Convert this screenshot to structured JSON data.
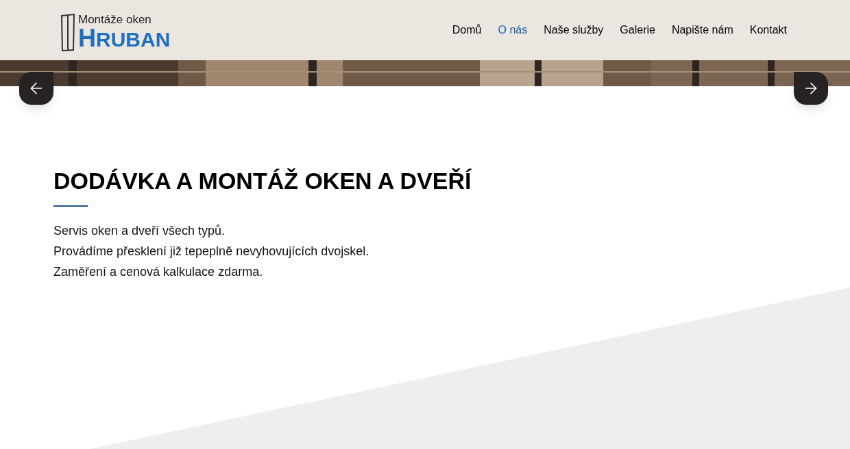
{
  "logo": {
    "tagline": "Montáže oken",
    "name": "HRUBAN"
  },
  "nav": [
    {
      "label": "Domů",
      "selected": false
    },
    {
      "label": "O nás",
      "selected": true
    },
    {
      "label": "Naše služby",
      "selected": false
    },
    {
      "label": "Galerie",
      "selected": false
    },
    {
      "label": "Napište nám",
      "selected": false
    },
    {
      "label": "Kontakt",
      "selected": false
    }
  ],
  "heading": "DODÁVKA A MONTÁŽ OKEN A DVEŘÍ",
  "lines": [
    "Servis oken a dveří všech typů.",
    "Provádíme přesklení již tepeplně nevyhovujících dvojskel.",
    "Zaměření a cenová kalkulace zdarma."
  ]
}
